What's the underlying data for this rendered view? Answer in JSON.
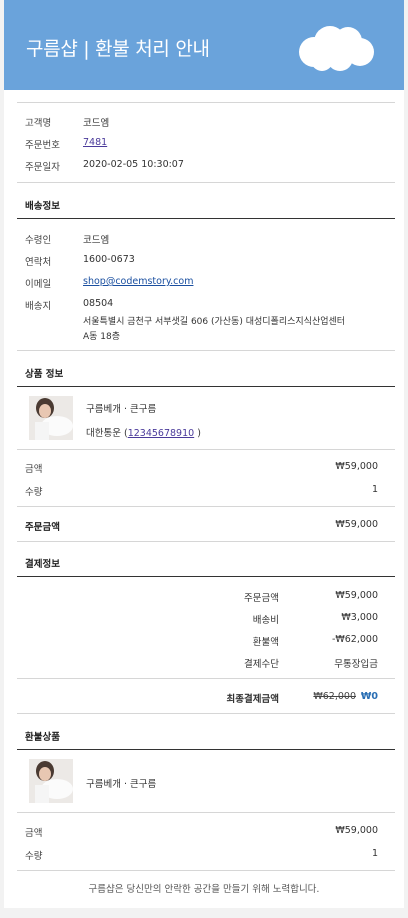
{
  "header": {
    "title": "구름샵 | 환불 처리 안내"
  },
  "customer": {
    "name_label": "고객명",
    "name": "코드엠",
    "order_no_label": "주문번호",
    "order_no": "7481",
    "order_date_label": "주문일자",
    "order_date": "2020-02-05 10:30:07"
  },
  "shipping": {
    "title": "배송정보",
    "recipient_label": "수령인",
    "recipient": "코드엠",
    "phone_label": "연락처",
    "phone": "1600-0673",
    "email_label": "이메일",
    "email": "shop@codemstory.com",
    "address_label": "배송지",
    "zip": "08504",
    "addr1": "서울특별시 금천구 서부샛길 606 (가산동) 대성디폴리스지식산업센터",
    "addr2": "A동 18층"
  },
  "product": {
    "title": "상품 정보",
    "name": "구름베개 · 큰구름",
    "courier_prefix": "대한통운 (",
    "tracking": "12345678910",
    "courier_suffix": ")",
    "amount_label": "금액",
    "amount": "₩59,000",
    "qty_label": "수량",
    "qty": "1",
    "order_total_label": "주문금액",
    "order_total": "₩59,000"
  },
  "payment": {
    "title": "결제정보",
    "order_amount_label": "주문금액",
    "order_amount": "₩59,000",
    "shipping_label": "배송비",
    "shipping": "₩3,000",
    "refund_label": "환불액",
    "refund": "-₩62,000",
    "method_label": "결제수단",
    "method": "무통장입금",
    "final_label": "최종결제금액",
    "final_original": "₩62,000",
    "final": "₩0"
  },
  "refund_item": {
    "title": "환불상품",
    "name": "구름베개 · 큰구름",
    "amount_label": "금액",
    "amount": "₩59,000",
    "qty_label": "수량",
    "qty": "1"
  },
  "footer": {
    "text": "구름샵은 당신만의 안락한 공간을 만들기 위해 노력합니다."
  },
  "colors": {
    "header": "#6aa3db",
    "link": "#4a3a9a",
    "accent": "#2a6fb4"
  }
}
